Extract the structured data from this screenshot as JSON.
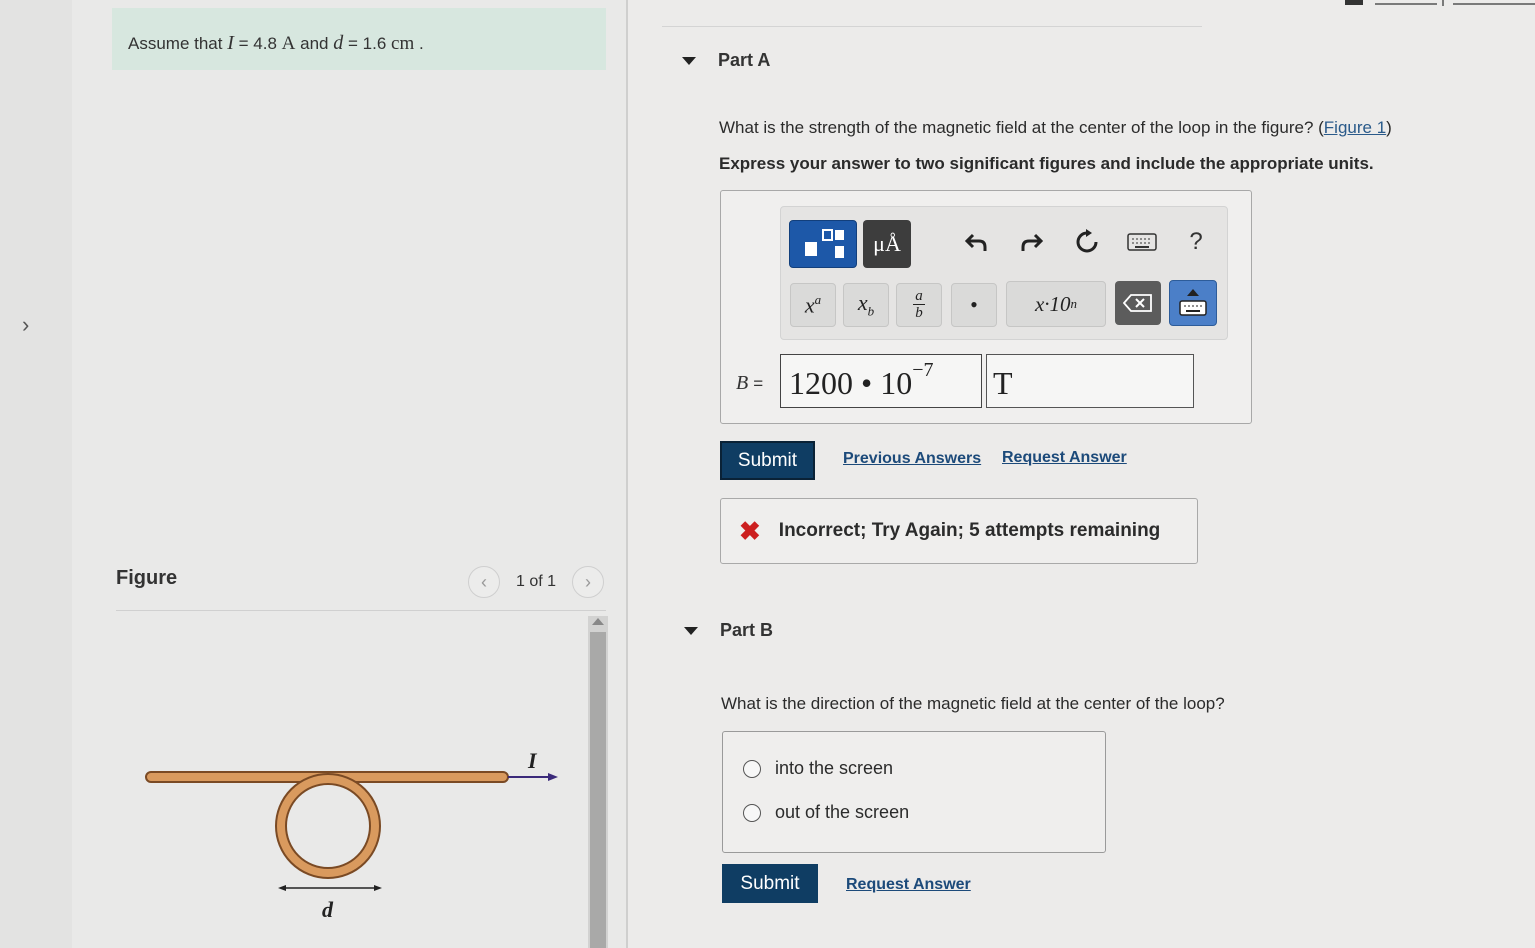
{
  "assume": {
    "prefix": "Assume that",
    "var_i": "I",
    "eq1": "= 4.8",
    "unit_i": "A",
    "and": "and",
    "var_d": "d",
    "eq2": "= 1.6",
    "unit_d": "cm",
    "suffix": "."
  },
  "figure": {
    "title": "Figure",
    "page_count": "1 of 1",
    "current_label": "I",
    "distance_label": "d"
  },
  "part_a": {
    "title": "Part A",
    "question": "What is the strength of the magnetic field at the center of the loop in the figure? (",
    "figure_link": "Figure 1",
    "question_end": ")",
    "instruction": "Express your answer to two significant figures and include the appropriate units.",
    "toolbar": {
      "units_label": "μÅ",
      "help_label": "?",
      "superscript_label": "xa",
      "subscript_label": "xb",
      "fraction_num": "a",
      "fraction_den": "b",
      "dot_label": "•",
      "sci_label": "x·10",
      "sci_exp": "n"
    },
    "var_label": "B",
    "equals": "=",
    "value_base": "1200 • 10",
    "value_exp": "−7",
    "unit_value": "T",
    "submit": "Submit",
    "previous_answers": "Previous Answers",
    "request_answer": "Request Answer",
    "feedback": "Incorrect; Try Again; 5 attempts remaining"
  },
  "part_b": {
    "title": "Part B",
    "question": "What is the direction of the magnetic field at the center of the loop?",
    "options": [
      "into the screen",
      "out of the screen"
    ],
    "submit": "Submit",
    "request_answer": "Request Answer"
  }
}
